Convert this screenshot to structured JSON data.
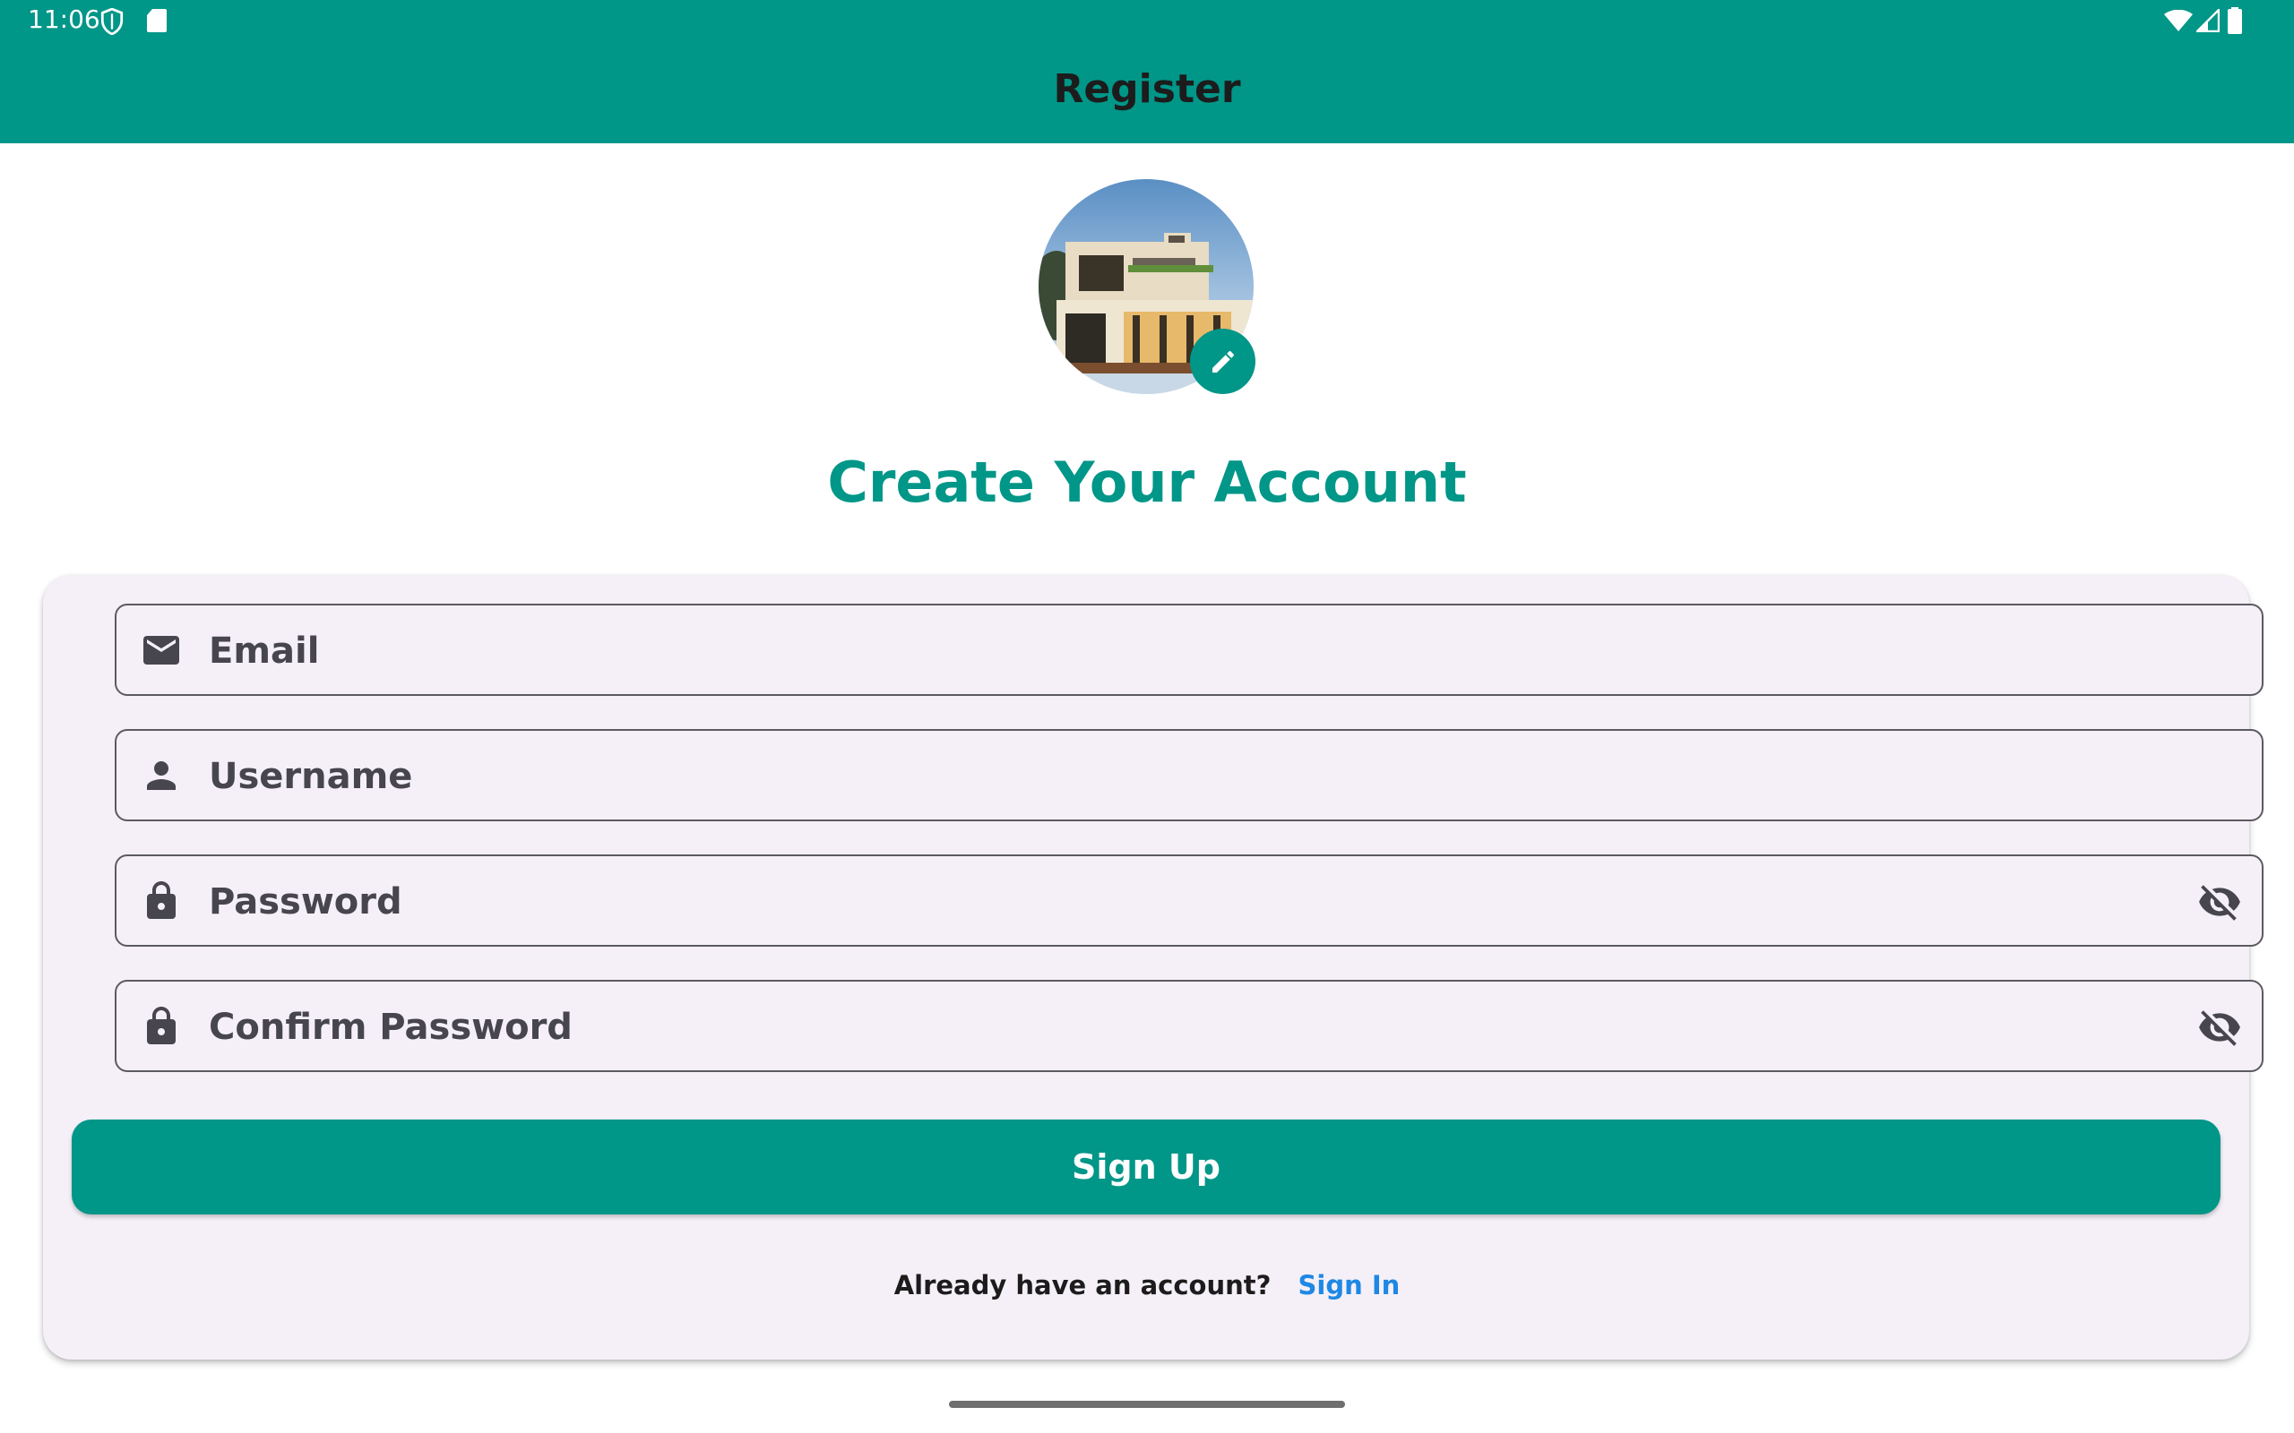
{
  "status_bar": {
    "time": "11:06",
    "icons": [
      "shield-icon",
      "sd-card-icon",
      "wifi-icon",
      "signal-icon",
      "battery-icon"
    ]
  },
  "app_bar": {
    "title": "Register"
  },
  "avatar": {
    "alt": "house photo",
    "edit_icon": "pencil-icon"
  },
  "heading": "Create Your Account",
  "form": {
    "email": {
      "label": "Email",
      "icon": "mail-icon"
    },
    "username": {
      "label": "Username",
      "icon": "person-icon"
    },
    "password": {
      "label": "Password",
      "icon": "lock-icon",
      "toggle_icon": "visibility-off-icon"
    },
    "confirm_password": {
      "label": "Confirm Password",
      "icon": "lock-icon",
      "toggle_icon": "visibility-off-icon"
    },
    "submit_label": "Sign Up"
  },
  "footer": {
    "question": "Already have an account?",
    "link": "Sign In"
  },
  "colors": {
    "primary": "#009688",
    "card": "#f5f0f7",
    "link": "#1e88e5",
    "heading": "#009688"
  }
}
